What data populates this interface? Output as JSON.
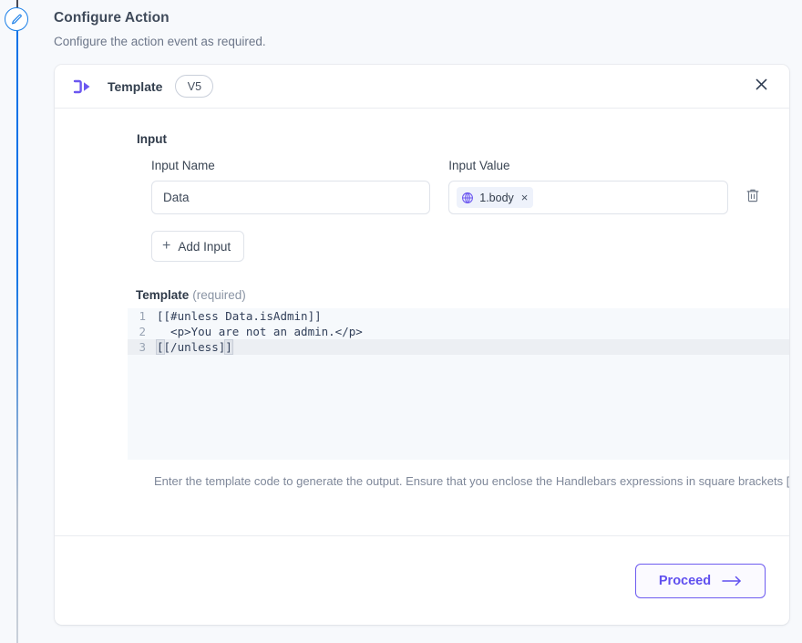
{
  "page": {
    "title": "Configure Action",
    "subtitle": "Configure the action event as required."
  },
  "rail": {
    "node_icon": "pencil-icon"
  },
  "card": {
    "header": {
      "icon": "template-node-icon",
      "title": "Template",
      "version": "V5",
      "close_icon": "close-icon"
    },
    "input_section": {
      "heading": "Input",
      "col_name_label": "Input Name",
      "col_value_label": "Input Value",
      "rows": [
        {
          "name_value": "Data",
          "chips": [
            {
              "icon": "globe-icon",
              "label": "1.body",
              "remove_icon": "×"
            }
          ],
          "delete_icon": "trash-icon"
        }
      ],
      "add_button": {
        "icon": "plus-icon",
        "label": "Add Input"
      }
    },
    "template_section": {
      "label": "Template",
      "required_note": "(required)",
      "editor": {
        "lines": [
          {
            "number": "1",
            "text": "[[#unless Data.isAdmin]]",
            "active": false
          },
          {
            "number": "2",
            "text": "  <p>You are not an admin.</p>",
            "active": false
          },
          {
            "number": "3",
            "text": "[[/unless]]",
            "active": true
          }
        ]
      },
      "hint": "Enter the template code to generate the output. Ensure that you enclose the Handlebars expressions in square brackets [[]]."
    },
    "footer": {
      "proceed_label": "Proceed",
      "proceed_arrow": "arrow-right-icon"
    }
  },
  "colors": {
    "accent_purple": "#6050ef",
    "rail_blue": "#0b72e7",
    "page_bg": "#f7f9fc",
    "editor_bg": "#f6f9fc"
  }
}
